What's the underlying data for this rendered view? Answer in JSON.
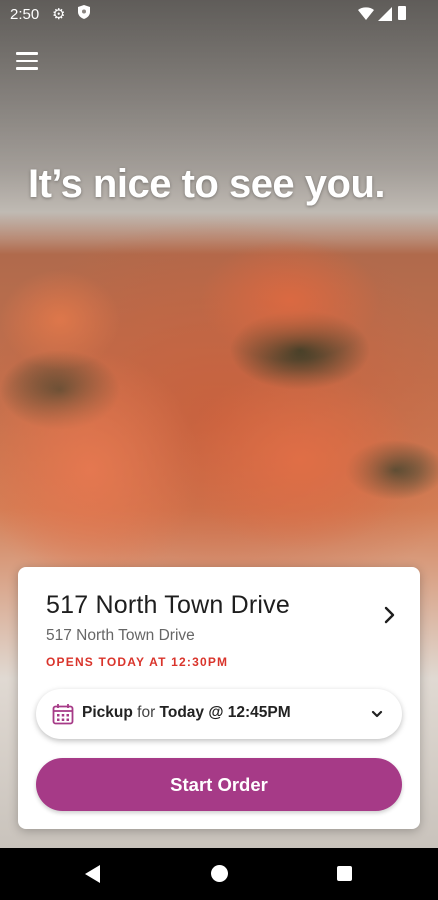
{
  "status_bar": {
    "time": "2:50",
    "icons": [
      "gear-icon",
      "shield-icon",
      "wifi-icon",
      "signal-icon",
      "battery-icon"
    ]
  },
  "header": {
    "menu_icon": "hamburger-menu-icon"
  },
  "hero": {
    "greeting": "It’s nice to see you."
  },
  "location_card": {
    "title": "517 North Town Drive",
    "address": "517 North Town Drive",
    "hours": "OPENS TODAY AT 12:30PM",
    "chevron_icon": "chevron-right-icon"
  },
  "pickup_selector": {
    "mode": "Pickup",
    "connector": "for",
    "time": "Today @ 12:45PM",
    "icon": "calendar-icon",
    "caret_icon": "chevron-down-icon"
  },
  "actions": {
    "start_order": "Start Order"
  },
  "colors": {
    "accent": "#a63a87",
    "hours_text": "#d9342b",
    "calendar_icon": "#a63a87"
  },
  "nav_bar": {
    "icons": [
      "back-icon",
      "home-icon",
      "recents-icon"
    ]
  }
}
